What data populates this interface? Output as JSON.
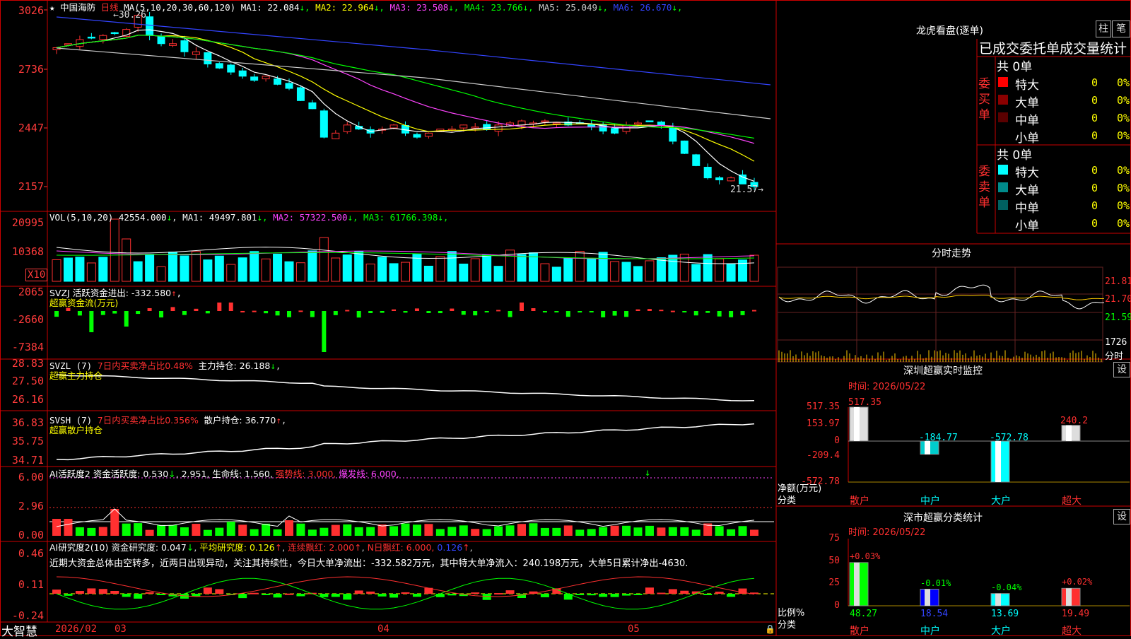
{
  "main": {
    "stock_name": "中国海防",
    "period": "日线",
    "ma_legend": "MA(5,10,20,30,60,120)",
    "ma_values": [
      {
        "label": "MA1",
        "value": "22.084",
        "color": "#ffffff"
      },
      {
        "label": "MA2",
        "value": "22.964",
        "color": "#ffff00"
      },
      {
        "label": "MA3",
        "value": "23.508",
        "color": "#ff44ff"
      },
      {
        "label": "MA4",
        "value": "23.766",
        "color": "#00ff00"
      },
      {
        "label": "MA5",
        "value": "25.049",
        "color": "#cccccc"
      },
      {
        "label": "MA6",
        "value": "26.670",
        "color": "#3344ff"
      }
    ],
    "y_ticks": [
      "3026",
      "2736",
      "2447",
      "2157"
    ],
    "high_mark": "30.26",
    "low_mark": "21.57"
  },
  "vol": {
    "legend": "VOL(5,10,20)",
    "value": "42554.000",
    "ma": [
      {
        "label": "MA1",
        "value": "49497.801",
        "color": "#ffffff"
      },
      {
        "label": "MA2",
        "value": "57322.500",
        "color": "#ff44ff"
      },
      {
        "label": "MA3",
        "value": "61766.398",
        "color": "#00ff00"
      }
    ],
    "y_ticks": [
      "20995",
      "10368"
    ],
    "unit": "X10"
  },
  "svzj": {
    "line1": "SVZJ  活跃资金进出: -332.580",
    "line2": "超赢资金流(万元)",
    "y_ticks": [
      "2065",
      "-2660",
      "-7384"
    ]
  },
  "svzl": {
    "name": "SVZL (7)",
    "desc": "7日内买卖净占比0.48%",
    "value": "主力持仓: 26.188",
    "line2": "超赢主力持仓",
    "y_ticks": [
      "28.83",
      "27.50",
      "26.16"
    ]
  },
  "svsh": {
    "name": "SVSH (7)",
    "desc": "7日内买卖净占比0.356%",
    "value": "散户持仓: 36.770",
    "line2": "超赢散户持仓",
    "y_ticks": [
      "36.83",
      "35.75",
      "34.71"
    ]
  },
  "ai1": {
    "name": "AI活跃度2",
    "v1": "资金活跃度: 0.530",
    "v2": "2.951,",
    "v3": "生命线: 1.560,",
    "v4": "强势线: 3.000,",
    "v5": "爆发线: 6.000,",
    "y_ticks": [
      "6.00",
      "2.96",
      "0.00"
    ]
  },
  "ai2": {
    "name": "AI研究度2(10)",
    "v1": "资金研究度: 0.047",
    "v2": "平均研究度: 0.126",
    "v3": "连续飘红: 2.000",
    "v4": "N日飘红: 6.000,",
    "v5": "0.126",
    "commentary": "近期大资金总体由空转多，近两日出现异动，关注其持续性，今日大单净流出：-332.582万元，其中特大单净流入：240.198万元，大单5日累计净出-4630.",
    "y_ticks": [
      "0.46",
      "0.11",
      "-0.24"
    ]
  },
  "bottom": {
    "brand": "大智慧",
    "dates": [
      "2026/02",
      "03",
      "04",
      "05"
    ]
  },
  "dragon": {
    "title": "龙虎看盘(逐单)",
    "btn1": "柱",
    "btn2": "笔",
    "subtitle": "已成交委托单成交量统计",
    "buy_label": "委买单",
    "sell_label": "委卖单",
    "buy_total": "共 0单",
    "sell_total": "共 0单",
    "buy_rows": [
      {
        "label": "特大",
        "count": "0",
        "pct": "0%",
        "color": "#ff0000"
      },
      {
        "label": "大单",
        "count": "0",
        "pct": "0%",
        "color": "#8b0000"
      },
      {
        "label": "中单",
        "count": "0",
        "pct": "0%",
        "color": "#5a0000"
      },
      {
        "label": "小单",
        "count": "0",
        "pct": "0%",
        "color": ""
      }
    ],
    "sell_rows": [
      {
        "label": "特大",
        "count": "0",
        "pct": "0%",
        "color": "#00ffff"
      },
      {
        "label": "大单",
        "count": "0",
        "pct": "0%",
        "color": "#008b8b"
      },
      {
        "label": "中单",
        "count": "0",
        "pct": "0%",
        "color": "#006060"
      },
      {
        "label": "小单",
        "count": "0",
        "pct": "0%",
        "color": ""
      }
    ]
  },
  "intraday": {
    "title": "分时走势",
    "prices": [
      "21.81",
      "21.70",
      "21.59"
    ],
    "vol": "1726",
    "unit": "分时"
  },
  "monitor": {
    "title": "深圳超赢实时监控",
    "set": "设",
    "time": "时间: 2026/05/22",
    "y_ticks": [
      "517.35",
      "153.97",
      "0",
      "-209.4",
      "-572.78"
    ],
    "axis_label1": "净额(万元)",
    "axis_label2": "分类",
    "chart_data": {
      "type": "bar",
      "categories": [
        "散户",
        "中户",
        "大户",
        "超大"
      ],
      "values": [
        517.35,
        -184.77,
        -572.78,
        240.2
      ],
      "value_labels": [
        "517.35",
        "-184.77",
        "-572.78",
        "240.2"
      ],
      "ylim": [
        -572.78,
        517.35
      ]
    }
  },
  "classify": {
    "title": "深市超赢分类统计",
    "set": "设",
    "time": "时间: 2026/05/22",
    "y_ticks": [
      "75",
      "50",
      "25",
      "0"
    ],
    "axis_label1": "比例%",
    "axis_label2": "分类",
    "chart_data": {
      "type": "bar",
      "categories": [
        "散户",
        "中户",
        "大户",
        "超大"
      ],
      "values": [
        48.27,
        18.54,
        13.69,
        19.49
      ],
      "changes": [
        "+0.03%",
        "-0.01%",
        "-0.04%",
        "+0.02%"
      ],
      "ylim": [
        0,
        75
      ]
    }
  },
  "colors": {
    "up": "#ff3030",
    "down": "#00ffff",
    "frame": "#cc0000",
    "green": "#00ff00"
  }
}
